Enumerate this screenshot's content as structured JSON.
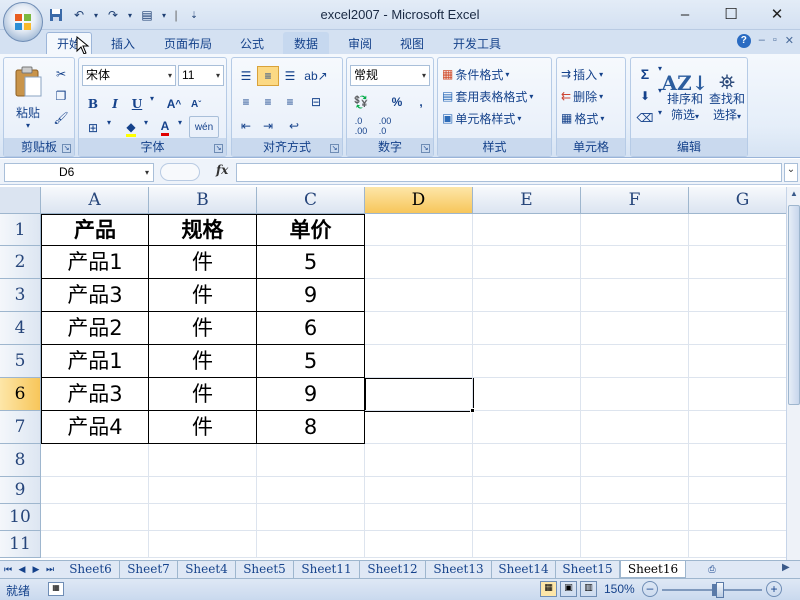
{
  "window": {
    "title": "excel2007 - Microsoft Excel",
    "controls": [
      "–",
      "☐",
      "✕"
    ]
  },
  "ribbon_tabs": [
    {
      "label": "开始",
      "active": true
    },
    {
      "label": "插入",
      "active": false
    },
    {
      "label": "页面布局",
      "active": false
    },
    {
      "label": "公式",
      "active": false
    },
    {
      "label": "数据",
      "active": false
    },
    {
      "label": "审阅",
      "active": false
    },
    {
      "label": "视图",
      "active": false
    },
    {
      "label": "开发工具",
      "active": false
    }
  ],
  "groups": {
    "clipboard": {
      "label": "剪贴板",
      "paste": "粘贴"
    },
    "font": {
      "label": "字体",
      "font_name": "宋体",
      "font_size": "11",
      "bold": "B",
      "italic": "I",
      "underline": "U"
    },
    "alignment": {
      "label": "对齐方式"
    },
    "number": {
      "label": "数字",
      "format": "常规",
      "percent": "%",
      "comma": ","
    },
    "styles": {
      "label": "样式",
      "conditional": "条件格式",
      "table": "套用表格格式",
      "cell_styles": "单元格样式"
    },
    "cells": {
      "label": "单元格",
      "insert": "插入",
      "delete": "删除",
      "format": "格式"
    },
    "editing": {
      "label": "编辑",
      "sort_1": "排序和",
      "sort_2": "筛选",
      "find_1": "查找和",
      "find_2": "选择"
    }
  },
  "formula_bar": {
    "name_box": "D6",
    "fx": "fx",
    "formula": ""
  },
  "columns": [
    "A",
    "B",
    "C",
    "D",
    "E",
    "F",
    "G"
  ],
  "rows": [
    "1",
    "2",
    "3",
    "4",
    "5",
    "6",
    "7",
    "8",
    "9",
    "10",
    "11"
  ],
  "table": {
    "headers": [
      "产品",
      "规格",
      "单价"
    ],
    "rows": [
      [
        "产品1",
        "件",
        "5"
      ],
      [
        "产品3",
        "件",
        "9"
      ],
      [
        "产品2",
        "件",
        "6"
      ],
      [
        "产品1",
        "件",
        "5"
      ],
      [
        "产品3",
        "件",
        "9"
      ],
      [
        "产品4",
        "件",
        "8"
      ]
    ]
  },
  "active_cell": "D6",
  "sheets": [
    "Sheet6",
    "Sheet7",
    "Sheet4",
    "Sheet5",
    "Sheet11",
    "Sheet12",
    "Sheet13",
    "Sheet14",
    "Sheet15",
    "Sheet16"
  ],
  "active_sheet": "Sheet16",
  "status": {
    "mode": "就绪",
    "zoom": "150%"
  },
  "colors": {
    "accent": "#15428b",
    "selected_header": "#f7c65a",
    "ribbon_bg": "#e5eef9"
  }
}
